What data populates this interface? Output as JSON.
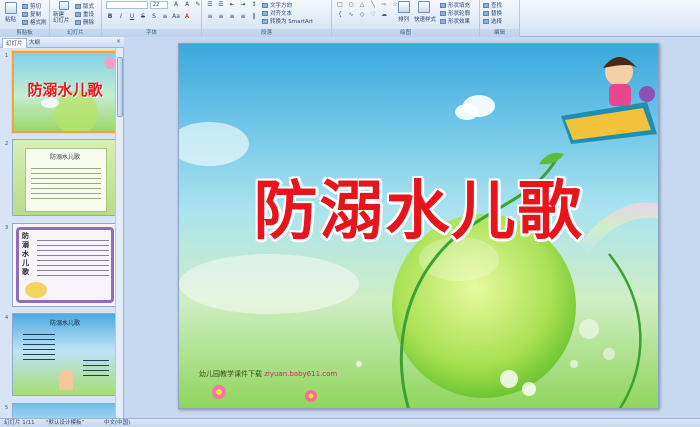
{
  "ribbon": {
    "clipboard": {
      "paste": "粘贴",
      "cut": "剪切",
      "copy": "复制",
      "format_painter": "格式刷",
      "label": "剪贴板"
    },
    "slides": {
      "new_slide": "新建\n幻灯片",
      "layout": "版式",
      "reset": "重设",
      "delete": "删除",
      "label": "幻灯片"
    },
    "font": {
      "font_size": "22",
      "label": "字体"
    },
    "paragraph": {
      "text_direction": "文字方向",
      "align_text": "对齐文本",
      "smartart": "转换为 SmartArt",
      "label": "段落"
    },
    "drawing": {
      "arrange": "排列",
      "quick_styles": "快速样式",
      "shape_fill": "形状填充",
      "shape_outline": "形状轮廓",
      "shape_effects": "形状效果",
      "label": "绘图"
    },
    "editing": {
      "find": "查找",
      "replace": "替换",
      "select": "选择",
      "label": "编辑"
    }
  },
  "left_pane": {
    "tabs": [
      "幻灯片",
      "大纲"
    ],
    "close": "×",
    "thumbnails": [
      {
        "num": "1",
        "title": "防溺水儿歌"
      },
      {
        "num": "2",
        "title": "防溺水儿歌"
      },
      {
        "num": "3",
        "title": "防溺水儿歌"
      },
      {
        "num": "4",
        "title": "防溺水儿歌"
      },
      {
        "num": "5",
        "title": ""
      }
    ]
  },
  "slide": {
    "title": "防溺水儿歌",
    "footer_text": "幼儿园教学课件下载",
    "footer_url": "ziyuan.baby611.com"
  },
  "status": {
    "slide_index": "幻灯片 1/11",
    "theme": "\"默认设计模板\"",
    "language": "中文(中国)"
  },
  "colors": {
    "title_red": "#e8141c",
    "selected_border": "#f2a33b",
    "ribbon_bg": "#dce8f6"
  }
}
